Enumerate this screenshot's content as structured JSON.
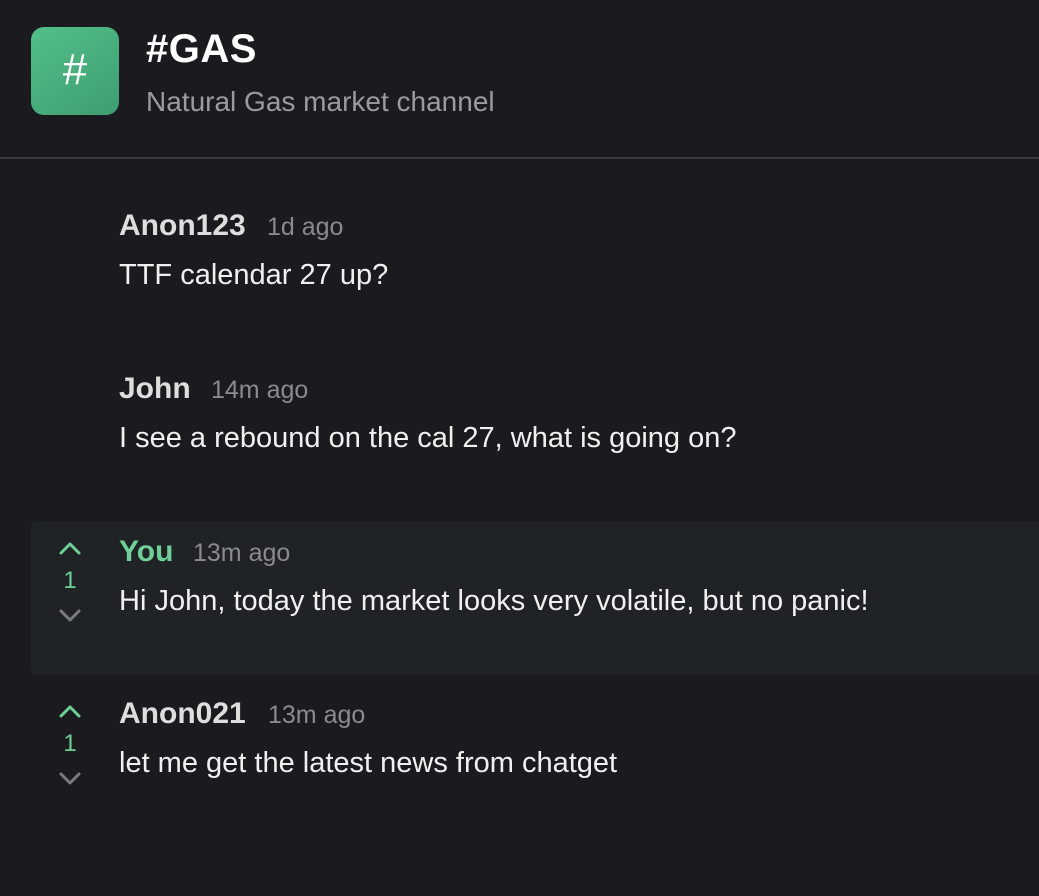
{
  "channel": {
    "icon_glyph": "#",
    "title": "#GAS",
    "description": "Natural Gas market channel",
    "accent_color": "#4cb482"
  },
  "messages": [
    {
      "author": "Anon123",
      "time": "1d ago",
      "text": "TTF calendar 27 up?",
      "is_self": false
    },
    {
      "author": "John",
      "time": "14m ago",
      "text": "I see a rebound on the cal 27, what is going on?",
      "is_self": false
    },
    {
      "author": "You",
      "time": "13m ago",
      "text": "Hi John, today the market looks very volatile, but no panic!",
      "is_self": true,
      "votes": "1",
      "upvote_icon": "chevron-up-icon",
      "downvote_icon": "chevron-down-icon"
    },
    {
      "author": "Anon021",
      "time": "13m ago",
      "text": "let me get the latest news from chatget",
      "is_self": false,
      "votes": "1",
      "upvote_icon": "chevron-up-icon",
      "downvote_icon": "chevron-down-icon"
    }
  ],
  "colors": {
    "background": "#1b1b1f",
    "highlight_background": "#1f2326",
    "self_author": "#6fcf97",
    "vote_up": "#6fcf97",
    "vote_down": "#7a7a80",
    "muted_text": "#8a8a90"
  }
}
